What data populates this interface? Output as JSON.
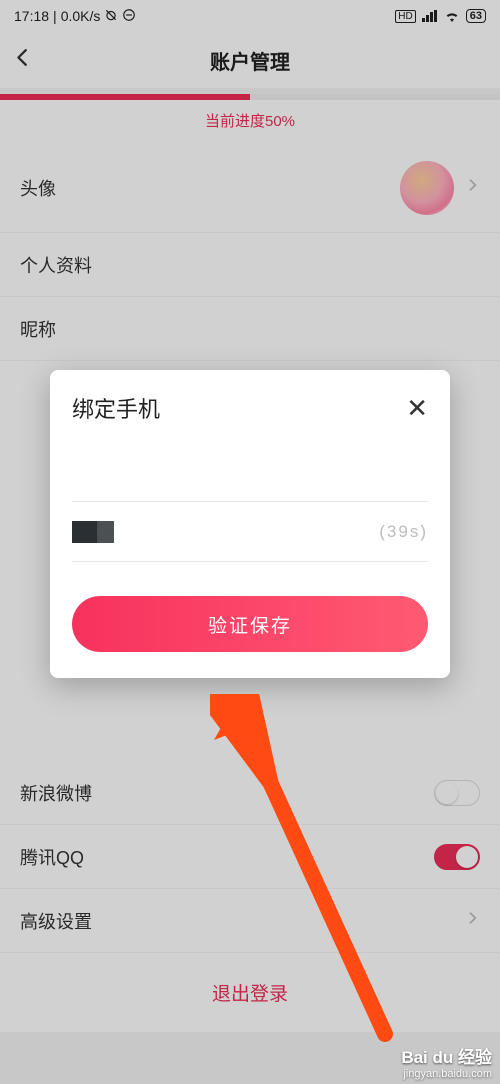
{
  "status": {
    "time": "17:18",
    "net_speed": "0.0K/s",
    "battery": "63"
  },
  "header": {
    "title": "账户管理"
  },
  "progress": {
    "percent": 50,
    "label": "当前进度50%"
  },
  "rows": {
    "avatar": "头像",
    "profile": "个人资料",
    "nickname": "昵称",
    "weibo": "新浪微博",
    "qq": "腾讯QQ",
    "advanced": "高级设置"
  },
  "logout": "退出登录",
  "modal": {
    "title": "绑定手机",
    "countdown": "(39s)",
    "primary": "验证保存"
  },
  "watermark": {
    "main": "Bai du 经验",
    "sub": "jingyan.baidu.com"
  },
  "toggles": {
    "weibo_on": false,
    "qq_on": true
  }
}
